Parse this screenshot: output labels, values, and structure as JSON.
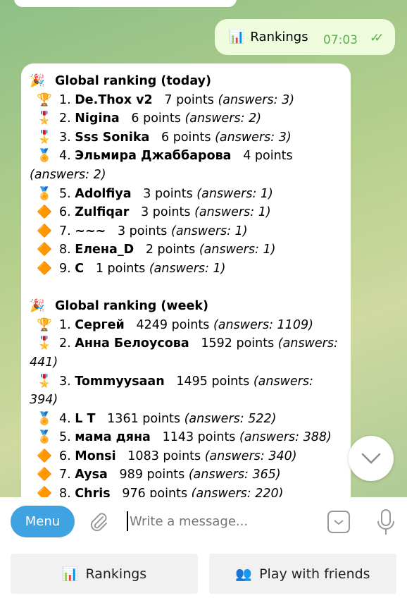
{
  "outgoing": {
    "icon": "bar-chart-icon",
    "text": "Rankings",
    "time": "07:03",
    "status": "read"
  },
  "message": {
    "sections": [
      {
        "title": "Global ranking (today)",
        "title_icon": "party-popper-icon",
        "rows": [
          {
            "emoji": "🏆",
            "rank": "1.",
            "name": "De.Thox v2",
            "points": "7 points",
            "answers": "(answers: 3)"
          },
          {
            "emoji": "🎖️",
            "rank": "2.",
            "name": "Nigina",
            "points": "6 points",
            "answers": "(answers: 2)"
          },
          {
            "emoji": "🎖️",
            "rank": "3.",
            "name": "Sss Sonika",
            "points": "6 points",
            "answers": "(answers: 3)"
          },
          {
            "emoji": "🏅",
            "rank": "4.",
            "name": "Эльмира Джаббарова",
            "points": "4 points",
            "answers": "(answers: 2)"
          },
          {
            "emoji": "🏅",
            "rank": "5.",
            "name": "Adolfiya",
            "points": "3 points",
            "answers": "(answers: 1)"
          },
          {
            "emoji": "🔶",
            "rank": "6.",
            "name": "Zulfiqar",
            "points": "3 points",
            "answers": "(answers: 1)"
          },
          {
            "emoji": "🔶",
            "rank": "7.",
            "name": "~~~",
            "points": "3 points",
            "answers": "(answers: 1)"
          },
          {
            "emoji": "🔶",
            "rank": "8.",
            "name": "Елена_D",
            "points": "2 points",
            "answers": "(answers: 1)"
          },
          {
            "emoji": "🔶",
            "rank": "9.",
            "name": "C",
            "points": "1 points",
            "answers": "(answers: 1)"
          }
        ]
      },
      {
        "title": "Global ranking (week)",
        "title_icon": "party-popper-icon",
        "rows": [
          {
            "emoji": "🏆",
            "rank": "1.",
            "name": "Сергей",
            "points": "4249 points",
            "answers": "(answers: 1109)"
          },
          {
            "emoji": "🎖️",
            "rank": "2.",
            "name": "Анна Белоусова",
            "points": "1592 points",
            "answers": "(answers: 441)"
          },
          {
            "emoji": "🎖️",
            "rank": "3.",
            "name": "Tommyysaan",
            "points": "1495 points",
            "answers": "(answers: 394)"
          },
          {
            "emoji": "🏅",
            "rank": "4.",
            "name": "L T",
            "points": "1361 points",
            "answers": "(answers: 522)"
          },
          {
            "emoji": "🏅",
            "rank": "5.",
            "name": "мама дяна",
            "points": "1143 points",
            "answers": "(answers: 388)"
          },
          {
            "emoji": "🔶",
            "rank": "6.",
            "name": "Monsi",
            "points": "1083 points",
            "answers": "(answers: 340)"
          },
          {
            "emoji": "🔶",
            "rank": "7.",
            "name": "Aysa",
            "points": "989 points",
            "answers": "(answers: 365)"
          },
          {
            "emoji": "🔶",
            "rank": "8.",
            "name": "Chris",
            "points": "976 points",
            "answers": "(answers: 220)"
          }
        ]
      }
    ]
  },
  "composer": {
    "menu_label": "Menu",
    "placeholder": "Write a message..."
  },
  "keyboard": [
    {
      "icon": "bar-chart-icon",
      "label": "Rankings"
    },
    {
      "icon": "two-people-icon",
      "label": "Play with friends"
    }
  ],
  "colors": {
    "accent": "#3fa3e2",
    "outgoing_bubble": "#effdde",
    "time_green": "#5aae4c"
  }
}
